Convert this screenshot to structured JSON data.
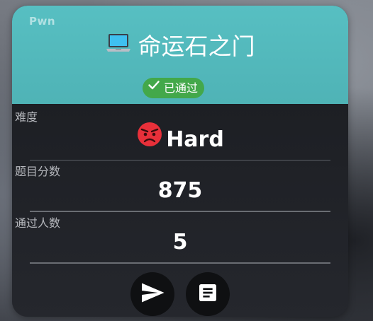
{
  "card": {
    "category": "Pwn",
    "title": "命运石之门",
    "title_icon": "laptop-icon",
    "status": {
      "label": "已通过",
      "icon": "check-icon",
      "color": "#43a84a"
    },
    "header_color": "#52b8bb"
  },
  "fields": {
    "difficulty": {
      "label": "难度",
      "value": "Hard",
      "icon": "angry-face-icon"
    },
    "score": {
      "label": "题目分数",
      "value": "875"
    },
    "solves": {
      "label": "通过人数",
      "value": "5"
    }
  },
  "actions": {
    "submit": {
      "icon": "send-icon"
    },
    "description": {
      "icon": "notes-icon"
    }
  }
}
